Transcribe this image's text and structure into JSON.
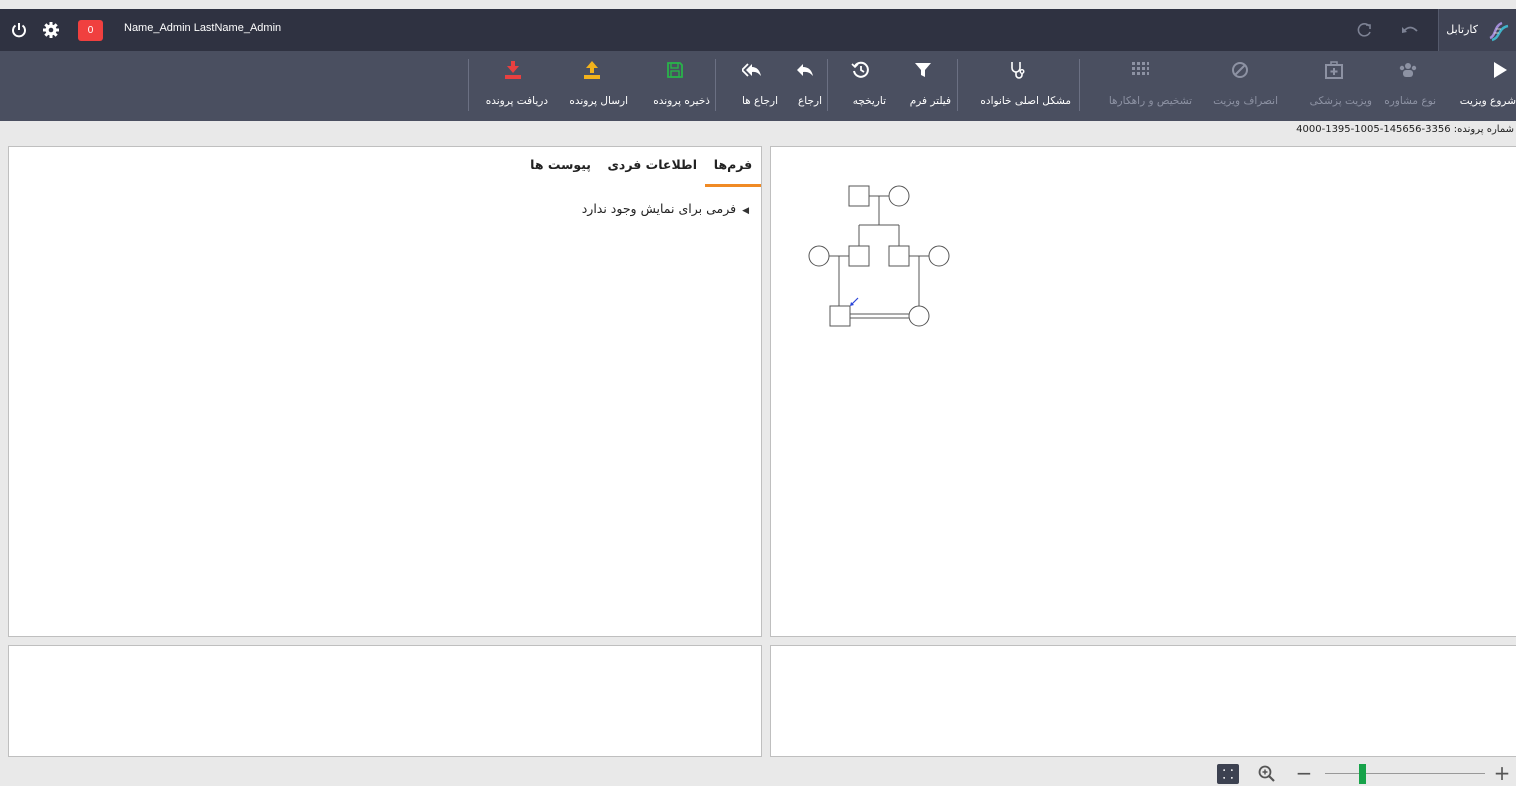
{
  "topbar": {
    "badge_count": "0",
    "user_name": "Name_Admin LastName_Admin",
    "cartable_label": "کارتابل"
  },
  "toolbar": {
    "start_visit": "شروع ویزیت",
    "consult_type": "نوع مشاوره",
    "medical_visit": "ویزیت پزشکی",
    "cancel_visit": "انصراف ویزیت",
    "diagnosis": "تشخیص و راهکارها",
    "family_problem": "مشکل اصلی خانواده",
    "form_filter": "فیلتر فرم",
    "history": "تاریخچه",
    "refer": "ارجاع",
    "refers": "ارجاع ها",
    "save_file": "ذخیره پرونده",
    "send_file": "ارسال پرونده",
    "receive_file": "دریافت پرونده"
  },
  "file": {
    "label": "شماره پرونده:",
    "number": "3356-145656-1005-1395-4000"
  },
  "tabs": {
    "forms": "فرم‌ها",
    "personal": "اطلاعات فردی",
    "attachments": "پیوست ها"
  },
  "forms_tree": {
    "empty": "فرمی برای نمایش وجود ندارد"
  },
  "colors": {
    "topbar": "#2f3241",
    "toolbar": "#4a4f60",
    "active_tab": "#f08a24",
    "download": "#e84040",
    "upload": "#f2b21c",
    "save": "#29b34a",
    "zoom_thumb": "#17a34a"
  },
  "icons": {
    "power": "power-icon",
    "settings": "gear-icon",
    "redo": "redo-icon",
    "undo": "undo-icon",
    "logo": "dna-logo-icon",
    "start": "play-icon",
    "consult": "users-icon",
    "medical": "medkit-icon",
    "cancel": "ban-icon",
    "diagnosis": "grid-icon",
    "family": "stethoscope-icon",
    "filter": "filter-icon",
    "history": "history-icon",
    "refer": "reply-icon",
    "refers": "reply-all-icon",
    "save": "floppy-icon",
    "upload": "upload-icon",
    "download": "download-icon",
    "zoom_fit": "fit-icon",
    "zoom": "zoom-in-icon"
  }
}
